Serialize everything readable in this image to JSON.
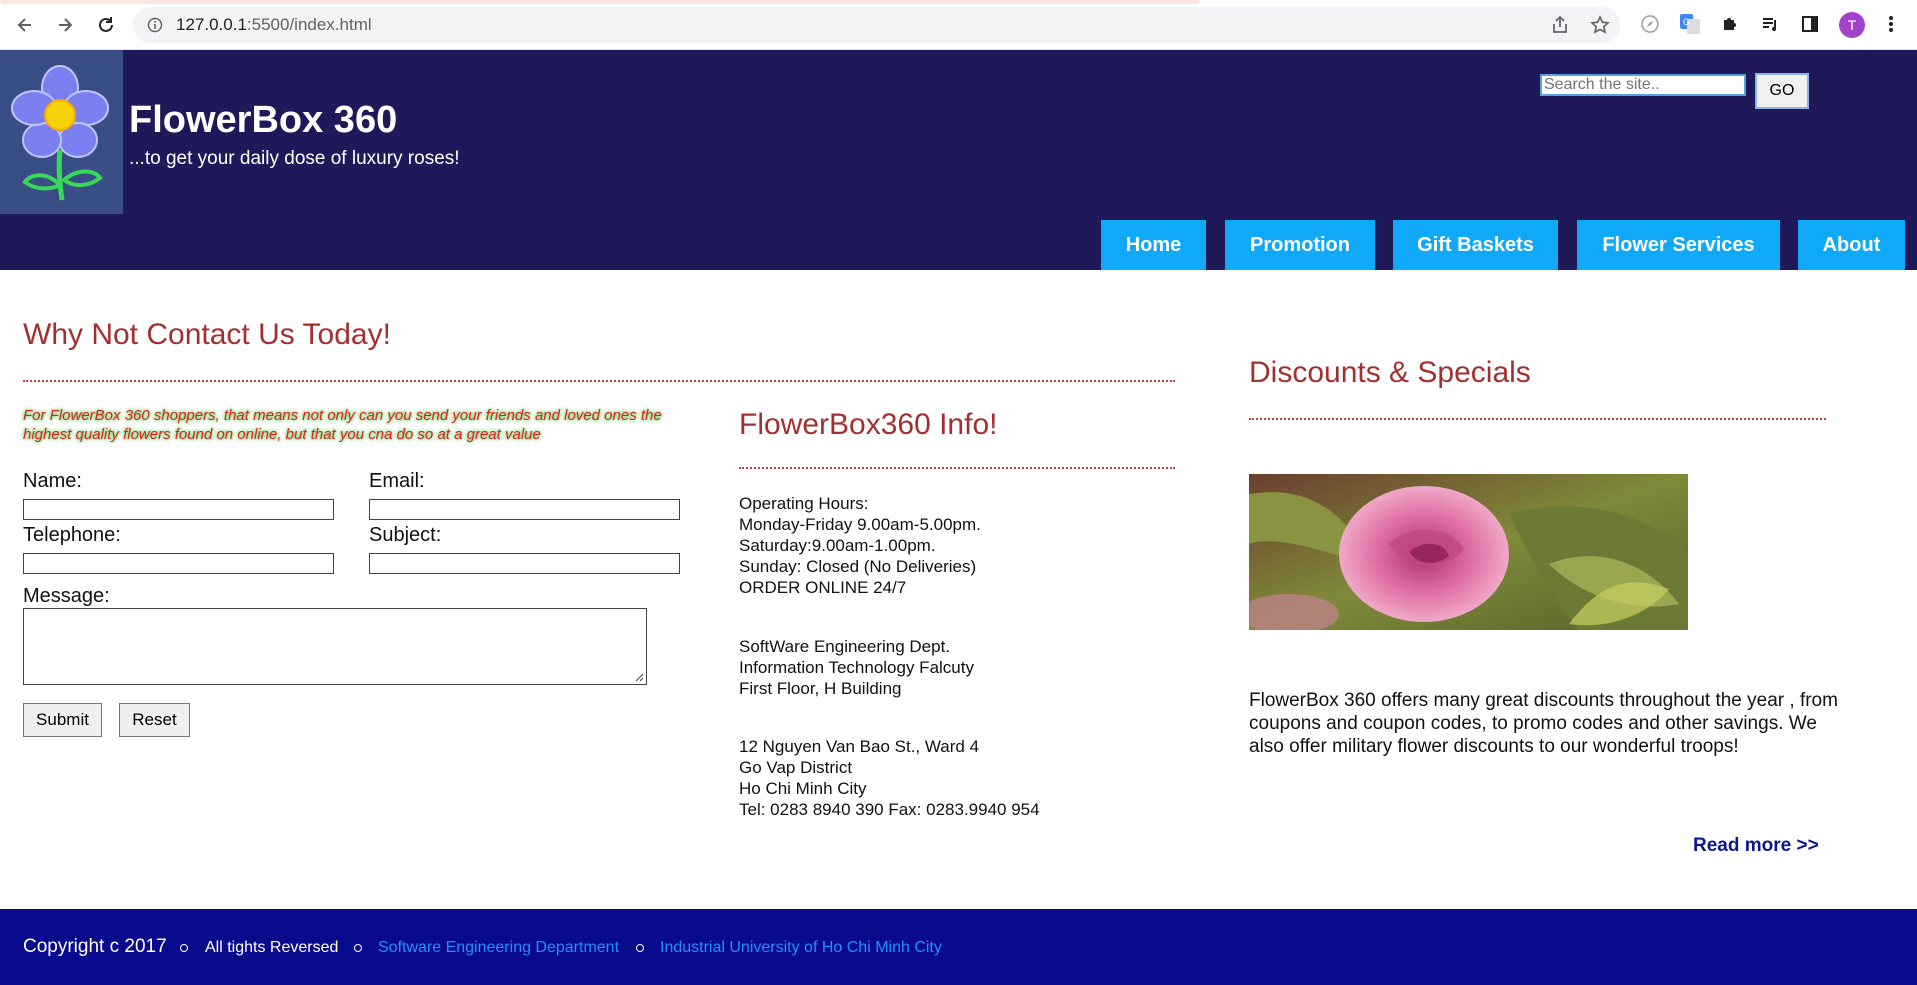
{
  "browser": {
    "url_host": "127.0.0.1",
    "url_path": ":5500/index.html",
    "avatar_letter": "T"
  },
  "header": {
    "title": "FlowerBox 360",
    "tagline": "...to get your daily dose of luxury roses!",
    "search_placeholder": "Search the site..",
    "go_label": "GO"
  },
  "menu": {
    "items": [
      {
        "label": "Home"
      },
      {
        "label": "Promotion"
      },
      {
        "label": "Gift Baskets"
      },
      {
        "label": "Flower Services"
      },
      {
        "label": "About"
      }
    ]
  },
  "contact": {
    "heading": "Why Not Contact Us Today!",
    "promo": "For FlowerBox 360 shoppers, that means not only can you send your friends and loved ones the highest quality flowers found on online, but that you cna do so at a great value",
    "name_label": "Name:",
    "email_label": "Email:",
    "telephone_label": "Telephone:",
    "subject_label": "Subject:",
    "message_label": "Message:",
    "submit_label": "Submit",
    "reset_label": "Reset"
  },
  "info": {
    "heading": "FlowerBox360 Info!",
    "hours": [
      "Operating Hours:",
      "Monday-Friday 9.00am-5.00pm.",
      "Saturday:9.00am-1.00pm.",
      "Sunday: Closed (No Deliveries)",
      "ORDER ONLINE 24/7"
    ],
    "dept": [
      "SoftWare Engineering Dept.",
      "Information Technology Falcuty",
      "First Floor, H Building"
    ],
    "address": [
      "12 Nguyen Van Bao St., Ward 4",
      "Go Vap District",
      "Ho Chi Minh City",
      "Tel: 0283 8940 390 Fax: 0283.9940 954"
    ]
  },
  "discounts": {
    "heading": "Discounts & Specials",
    "text": "FlowerBox 360 offers many great discounts throughout the year , from coupons and coupon codes, to promo codes and other savings. We also offer military flower discounts to our wonderful troops!",
    "read_more": "Read more >>"
  },
  "footer": {
    "copyright": "Copyright c 2017",
    "rights": "All tights Reversed",
    "link1": "Software Engineering Department",
    "link2": "Industrial University of Ho Chi Minh City"
  },
  "colors": {
    "header_bg": "#1f1859",
    "menu_bg": "#10a9f8",
    "heading_red": "#a33030",
    "footer_bg": "#0a0a8c",
    "footer_link": "#1e90ff"
  }
}
